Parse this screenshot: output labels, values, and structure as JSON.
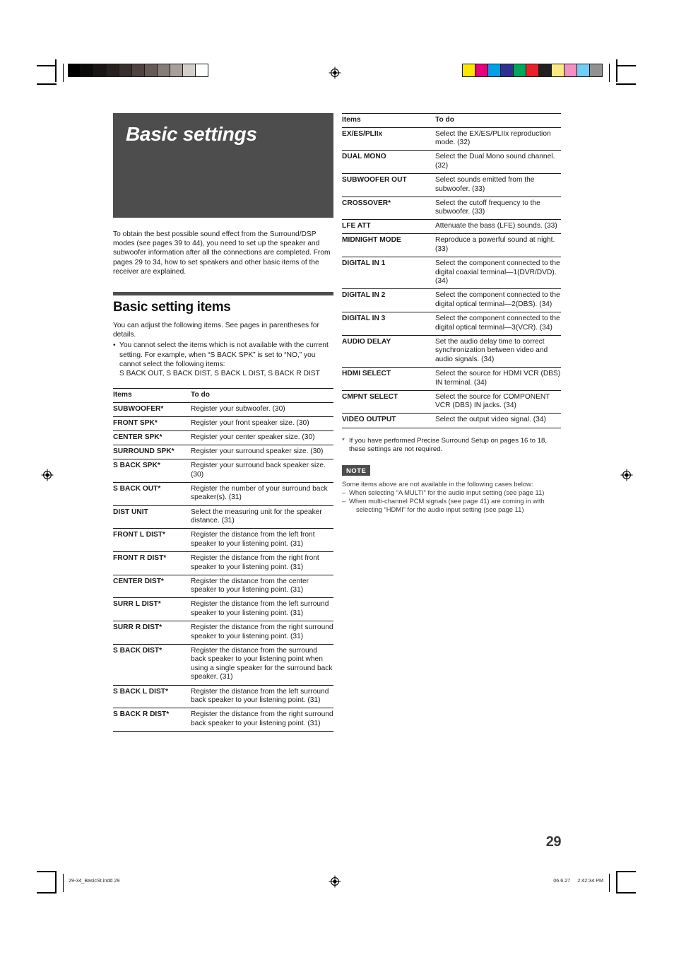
{
  "document": {
    "chapter_title": "Basic settings",
    "intro": "To obtain the best possible sound effect from the Surround/DSP modes (see pages 39 to 44), you need to set up the speaker and subwoofer information after all the connections are completed. From pages 29 to 34, how to set speakers and other basic items of the receiver are explained.",
    "page_number": "29"
  },
  "section": {
    "title": "Basic setting items",
    "lead": "You can adjust the following items. See pages in parentheses for details.",
    "bullet_mark": "•",
    "bullet": "You cannot select the items which is not available with the current setting. For example, when “S BACK SPK” is set to “NO,” you cannot select the following items:\nS BACK OUT, S BACK DIST, S BACK L DIST, S BACK R DIST"
  },
  "table_left": {
    "headers": {
      "items": "Items",
      "todo": "To do"
    },
    "rows": [
      {
        "item": "SUBWOOFER*",
        "todo": "Register your subwoofer. (30)"
      },
      {
        "item": "FRONT SPK*",
        "todo": "Register your front speaker size. (30)"
      },
      {
        "item": "CENTER SPK*",
        "todo": "Register your center speaker size. (30)"
      },
      {
        "item": "SURROUND SPK*",
        "todo": "Register your surround speaker size. (30)"
      },
      {
        "item": "S BACK SPK*",
        "todo": "Register your surround back speaker size. (30)"
      },
      {
        "item": "S BACK OUT*",
        "todo": "Register the number of your surround back speaker(s). (31)"
      },
      {
        "item": "DIST UNIT",
        "todo": "Select the measuring unit for the speaker distance. (31)"
      },
      {
        "item": "FRONT L DIST*",
        "todo": "Register the distance from the left front speaker to your listening point. (31)"
      },
      {
        "item": "FRONT R DIST*",
        "todo": "Register the distance from the right front speaker to your listening point. (31)"
      },
      {
        "item": "CENTER DIST*",
        "todo": "Register the distance from the center speaker to your listening point. (31)"
      },
      {
        "item": "SURR L DIST*",
        "todo": "Register the distance from the left surround speaker to your listening point. (31)"
      },
      {
        "item": "SURR R DIST*",
        "todo": "Register the distance from the right surround speaker to your listening point. (31)"
      },
      {
        "item": "S BACK DIST*",
        "todo": "Register the distance from the surround back speaker to your listening point when using a single speaker for the surround back speaker. (31)"
      },
      {
        "item": "S BACK L DIST*",
        "todo": "Register the distance from the left surround back speaker to your listening point. (31)"
      },
      {
        "item": "S BACK R DIST*",
        "todo": "Register the distance from the right surround back speaker to your listening point. (31)"
      }
    ]
  },
  "table_right": {
    "headers": {
      "items": "Items",
      "todo": "To do"
    },
    "rows": [
      {
        "item": "EX/ES/PLIIx",
        "todo": "Select the EX/ES/PLIIx reproduction mode. (32)"
      },
      {
        "item": "DUAL MONO",
        "todo": "Select the Dual Mono sound channel. (32)"
      },
      {
        "item": "SUBWOOFER OUT",
        "todo": "Select sounds emitted from the subwoofer. (33)"
      },
      {
        "item": "CROSSOVER*",
        "todo": "Select the cutoff frequency to the subwoofer. (33)"
      },
      {
        "item": "LFE ATT",
        "todo": "Attenuate the bass (LFE) sounds. (33)"
      },
      {
        "item": "MIDNIGHT MODE",
        "todo": "Reproduce a powerful sound at night. (33)"
      },
      {
        "item": "DIGITAL IN 1",
        "todo": "Select the component connected to the digital coaxial terminal—1(DVR/DVD). (34)"
      },
      {
        "item": "DIGITAL IN 2",
        "todo": "Select the component connected to the digital optical terminal—2(DBS). (34)"
      },
      {
        "item": "DIGITAL IN 3",
        "todo": "Select the component connected to the digital optical terminal—3(VCR). (34)"
      },
      {
        "item": "AUDIO DELAY",
        "todo": "Set the audio delay time to correct synchronization between video and audio signals. (34)"
      },
      {
        "item": "HDMI SELECT",
        "todo": "Select the source for HDMI VCR (DBS) IN terminal. (34)"
      },
      {
        "item": "CMPNT SELECT",
        "todo": "Select the source for COMPONENT VCR (DBS) IN jacks. (34)"
      },
      {
        "item": "VIDEO OUTPUT",
        "todo": "Select the output video signal. (34)"
      }
    ]
  },
  "footnote": {
    "mark": "*",
    "text": "If you have performed Precise Surround Setup on pages 16 to 18, these settings are not required."
  },
  "note": {
    "badge": "NOTE",
    "intro": "Some items above are not available in the following cases below:",
    "dash": "–",
    "line1": "When selecting “A MULTI” for the audio input setting (see page 11)",
    "line2": "When multi-channel PCM signals (see page 41) are coming in with",
    "line2_cont": "selecting “HDMI” for the audio input setting (see page 11)"
  },
  "print_marks": {
    "slug_left": "29-34_BasicSt.indd   29",
    "slug_date": "06.6.27",
    "slug_time": "2:42:34 PM",
    "grayscale_bar": [
      "#000000",
      "#0d0a0a",
      "#191514",
      "#26201f",
      "#38302e",
      "#4d4240",
      "#665a57",
      "#857b77",
      "#a89f9a",
      "#d5cfcb",
      "#ffffff"
    ],
    "color_bar": [
      "#ffe600",
      "#e6007e",
      "#00a0e9",
      "#2e3192",
      "#00a65a",
      "#e8202a",
      "#231f20",
      "#fbe97f",
      "#f491c0",
      "#72cdf4",
      "#919191"
    ]
  }
}
